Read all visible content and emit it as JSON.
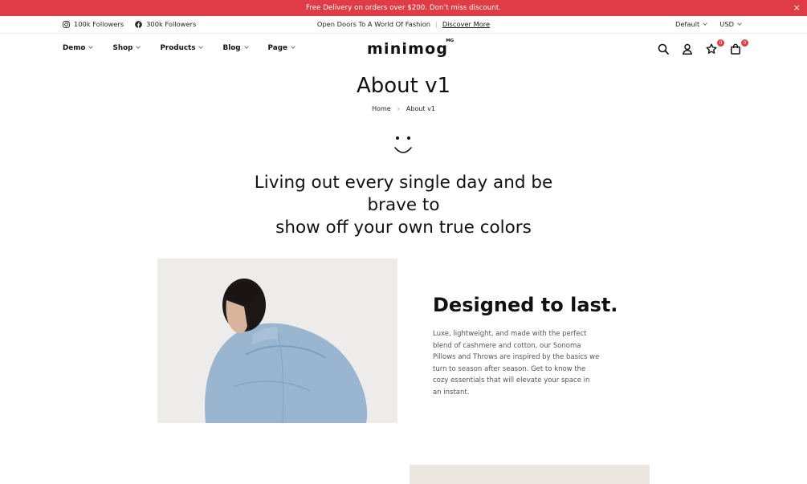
{
  "announcement": {
    "text": "Free Delivery on orders over $200. Don’t miss discount.",
    "close": "×"
  },
  "topbar": {
    "instagram_followers": "100k Followers",
    "facebook_followers": "300k Followers",
    "promo": "Open Doors To A World Of Fashion",
    "separator": "|",
    "promo_link": "Discover More",
    "language": "Default",
    "currency": "USD"
  },
  "nav": {
    "items": [
      "Demo",
      "Shop",
      "Products",
      "Blog",
      "Page"
    ]
  },
  "logo": {
    "text": "minimog",
    "sup": "MG"
  },
  "header_icons": {
    "wishlist_count": "0",
    "cart_count": "0"
  },
  "page": {
    "title": "About v1",
    "breadcrumb": [
      "Home",
      "About v1"
    ]
  },
  "quote": {
    "line1": "Living out every single day and be brave to",
    "line2": "show off your own true colors"
  },
  "feature": {
    "heading": "Designed to last.",
    "body": "Luxe, lightweight, and made with the perfect blend of cashmere and cotton, our Sonoma Pillows and Throws are inspired by the basics we turn to season after season. Get to know the cozy essentials that will elevate your space in an instant."
  },
  "colors": {
    "accent": "#e03c45",
    "denim": "#9ab5d0",
    "hair": "#1d1717"
  }
}
